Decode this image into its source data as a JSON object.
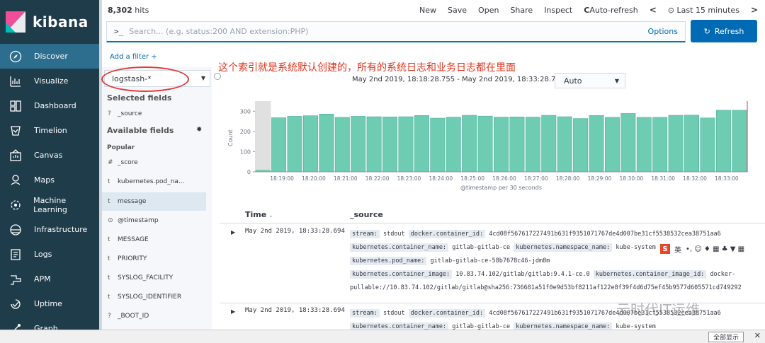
{
  "brand": {
    "name": "kibana"
  },
  "nav": [
    {
      "label": "Discover",
      "icon": "compass-icon",
      "active": true
    },
    {
      "label": "Visualize",
      "icon": "visualize-icon"
    },
    {
      "label": "Dashboard",
      "icon": "dashboard-icon"
    },
    {
      "label": "Timelion",
      "icon": "timelion-icon"
    },
    {
      "label": "Canvas",
      "icon": "canvas-icon"
    },
    {
      "label": "Maps",
      "icon": "maps-icon"
    },
    {
      "label": "Machine Learning",
      "icon": "ml-icon"
    },
    {
      "label": "Infrastructure",
      "icon": "infrastructure-icon"
    },
    {
      "label": "Logs",
      "icon": "logs-icon"
    },
    {
      "label": "APM",
      "icon": "apm-icon"
    },
    {
      "label": "Uptime",
      "icon": "uptime-icon"
    },
    {
      "label": "Graph",
      "icon": "graph-icon"
    }
  ],
  "topbar": {
    "hits_count": "8,302",
    "hits_label": " hits",
    "menu": [
      "New",
      "Save",
      "Open",
      "Share",
      "Inspect"
    ],
    "auto_refresh": "Auto-refresh",
    "time_range": "Last 15 minutes"
  },
  "search": {
    "prompt": ">_",
    "placeholder": "Search... (e.g. status:200 AND extension:PHP)",
    "options": "Options",
    "refresh": "Refresh"
  },
  "filters": {
    "add": "Add a filter +"
  },
  "index_pattern": "logstash-*",
  "fields": {
    "selected_title": "Selected fields",
    "selected": [
      {
        "type": "?",
        "name": "_source"
      }
    ],
    "available_title": "Available fields",
    "popular_title": "Popular",
    "popular": [
      {
        "type": "#",
        "name": "_score"
      },
      {
        "type": "t",
        "name": "kubernetes.pod_na..."
      },
      {
        "type": "t",
        "name": "message"
      }
    ],
    "others": [
      {
        "type": "⊙",
        "name": "@timestamp"
      },
      {
        "type": "t",
        "name": "MESSAGE"
      },
      {
        "type": "t",
        "name": "PRIORITY"
      },
      {
        "type": "t",
        "name": "SYSLOG_FACILITY"
      },
      {
        "type": "t",
        "name": "SYSLOG_IDENTIFIER"
      },
      {
        "type": "?",
        "name": "_BOOT_ID"
      }
    ]
  },
  "annotation": "这个索引就是系统默认创建的，所有的系统日志和业务日志都在里面",
  "histogram": {
    "range": "May 2nd 2019, 18:18:28.755 - May 2nd 2019, 18:33:28.755 —",
    "interval": "Auto"
  },
  "chart_data": {
    "type": "bar",
    "ylabel": "Count",
    "xlabel": "@timestamp per 30 seconds",
    "ylim": [
      0,
      350
    ],
    "yticks": [
      0,
      100,
      200,
      300
    ],
    "xticks": [
      "18:19:00",
      "18:20:00",
      "18:21:00",
      "18:22:00",
      "18:23:00",
      "18:24:00",
      "18:25:00",
      "18:26:00",
      "18:27:00",
      "18:28:00",
      "18:29:00",
      "18:30:00",
      "18:31:00",
      "18:32:00",
      "18:33:00"
    ],
    "values": [
      8,
      268,
      275,
      278,
      286,
      270,
      275,
      273,
      272,
      273,
      279,
      266,
      271,
      280,
      276,
      271,
      272,
      271,
      280,
      273,
      264,
      279,
      270,
      289,
      270,
      270,
      280,
      281,
      267,
      305,
      305
    ],
    "bar_color": "#6dccb1",
    "partial_bucket_shade": "#e0e0e0"
  },
  "table": {
    "col_time": "Time",
    "col_source": "_source",
    "rows": [
      {
        "time": "May 2nd 2019, 18:33:28.694",
        "lines": [
          [
            [
              "stream:",
              "stdout"
            ],
            [
              "docker.container_id:",
              "4cd08f567617227491b631f9351071767de4d007be31cf5538532cea38751aa6"
            ]
          ],
          [
            [
              "kubernetes.container_name:",
              "gitlab-gitlab-ce"
            ],
            [
              "kubernetes.namespace_name:",
              "kube-system"
            ]
          ],
          [
            [
              "kubernetes.pod_name:",
              "gitlab-gitlab-ce-58b7678c46-jdm8m"
            ]
          ],
          [
            [
              "kubernetes.container_image:",
              "10.83.74.102/gitlab/gitlab:9.4.1-ce.0"
            ],
            [
              "kubernetes.container_image_id:",
              "docker-"
            ]
          ],
          [
            [
              "",
              "pullable://10.83.74.102/gitlab/gitlab@sha256:736681a51f0e9d53bf8211af122e8f39f4d6d75ef45b9577d605571cd749292"
            ]
          ]
        ]
      },
      {
        "time": "May 2nd 2019, 18:33:28.694",
        "lines": [
          [
            [
              "stream:",
              "stdout"
            ],
            [
              "docker.container_id:",
              "4cd08f567617227491b631f9351071767de4d007be31cf5538532cea38751aa6"
            ]
          ],
          [
            [
              "kubernetes.container_name:",
              "gitlab-gitlab-ce"
            ],
            [
              "kubernetes.namespace_name:",
              "kube-system"
            ]
          ]
        ]
      }
    ]
  },
  "overlay": {
    "ime_label": "英",
    "watermark": "云时代IT运维",
    "bottom_button": "全部显示"
  }
}
